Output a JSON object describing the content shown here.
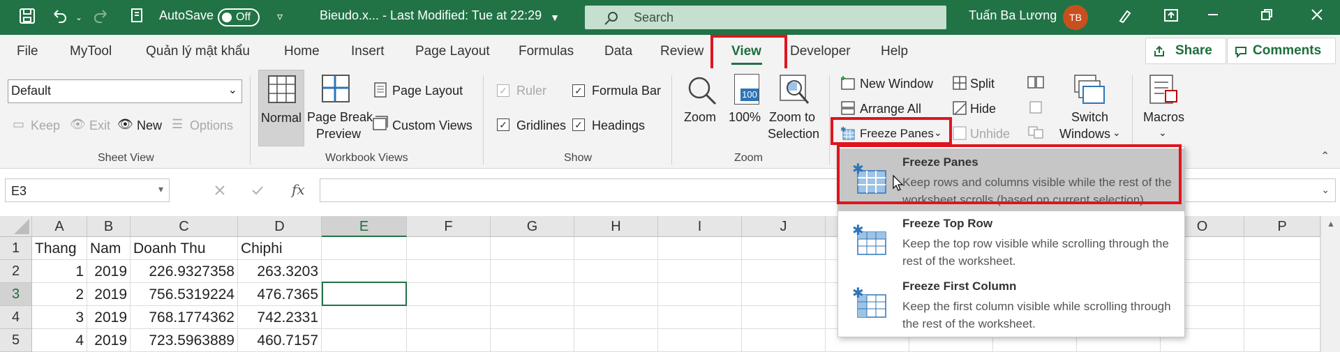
{
  "title_bar": {
    "autosave_label": "AutoSave",
    "autosave_state": "Off",
    "doc_title": "Bieudo.x...  -  Last Modified: Tue at 22:29",
    "search_placeholder": "Search",
    "user_name": "Tuấn Ba Lương",
    "avatar_initials": "TB",
    "accent": "#217346"
  },
  "tabs": [
    "File",
    "MyTool",
    "Quản lý mật khẩu",
    "Home",
    "Insert",
    "Page Layout",
    "Formulas",
    "Data",
    "Review",
    "View",
    "Developer",
    "Help"
  ],
  "active_tab": "View",
  "share_label": "Share",
  "comments_label": "Comments",
  "ribbon": {
    "sheet_view": {
      "dropdown_value": "Default",
      "keep": "Keep",
      "exit": "Exit",
      "new": "New",
      "options": "Options",
      "group_label": "Sheet View"
    },
    "workbook_views": {
      "normal": "Normal",
      "page_break_1": "Page Break",
      "page_break_2": "Preview",
      "page_layout": "Page Layout",
      "custom_views": "Custom Views",
      "group_label": "Workbook Views"
    },
    "show": {
      "ruler": "Ruler",
      "formula_bar": "Formula Bar",
      "gridlines": "Gridlines",
      "headings": "Headings",
      "group_label": "Show"
    },
    "zoom": {
      "zoom": "Zoom",
      "hundred": "100%",
      "hundred_icon": "100",
      "zoom_sel_1": "Zoom to",
      "zoom_sel_2": "Selection",
      "group_label": "Zoom"
    },
    "window": {
      "new_window": "New Window",
      "arrange_all": "Arrange All",
      "freeze_panes": "Freeze Panes",
      "split": "Split",
      "hide": "Hide",
      "unhide": "Unhide",
      "switch_1": "Switch",
      "switch_2": "Windows"
    },
    "macros": {
      "label": "Macros"
    }
  },
  "formula_bar": {
    "name_box": "E3",
    "fx": "fx",
    "value": ""
  },
  "grid": {
    "columns": [
      "A",
      "B",
      "C",
      "D",
      "E",
      "F",
      "G",
      "H",
      "I",
      "J",
      "",
      "",
      "",
      "",
      "O",
      "P"
    ],
    "rows": [
      "1",
      "2",
      "3",
      "4",
      "5"
    ],
    "selected_cell": "E3",
    "data": [
      [
        "Thang",
        "Nam",
        "Doanh Thu",
        "Chiphi"
      ],
      [
        "1",
        "2019",
        "226.9327358",
        "263.3203"
      ],
      [
        "2",
        "2019",
        "756.5319224",
        "476.7365"
      ],
      [
        "3",
        "2019",
        "768.1774362",
        "742.2331"
      ],
      [
        "4",
        "2019",
        "723.5963889",
        "460.7157"
      ]
    ]
  },
  "freeze_menu": [
    {
      "title": "Freeze Panes",
      "desc": "Keep rows and columns visible while the rest of the worksheet scrolls (based on current selection).",
      "icon": "freeze-panes-icon"
    },
    {
      "title": "Freeze Top Row",
      "desc": "Keep the top row visible while scrolling through the rest of the worksheet.",
      "icon": "freeze-top-row-icon"
    },
    {
      "title": "Freeze First Column",
      "desc": "Keep the first column visible while scrolling through the rest of the worksheet.",
      "icon": "freeze-first-column-icon"
    }
  ],
  "highlight_color": "#e0141e"
}
